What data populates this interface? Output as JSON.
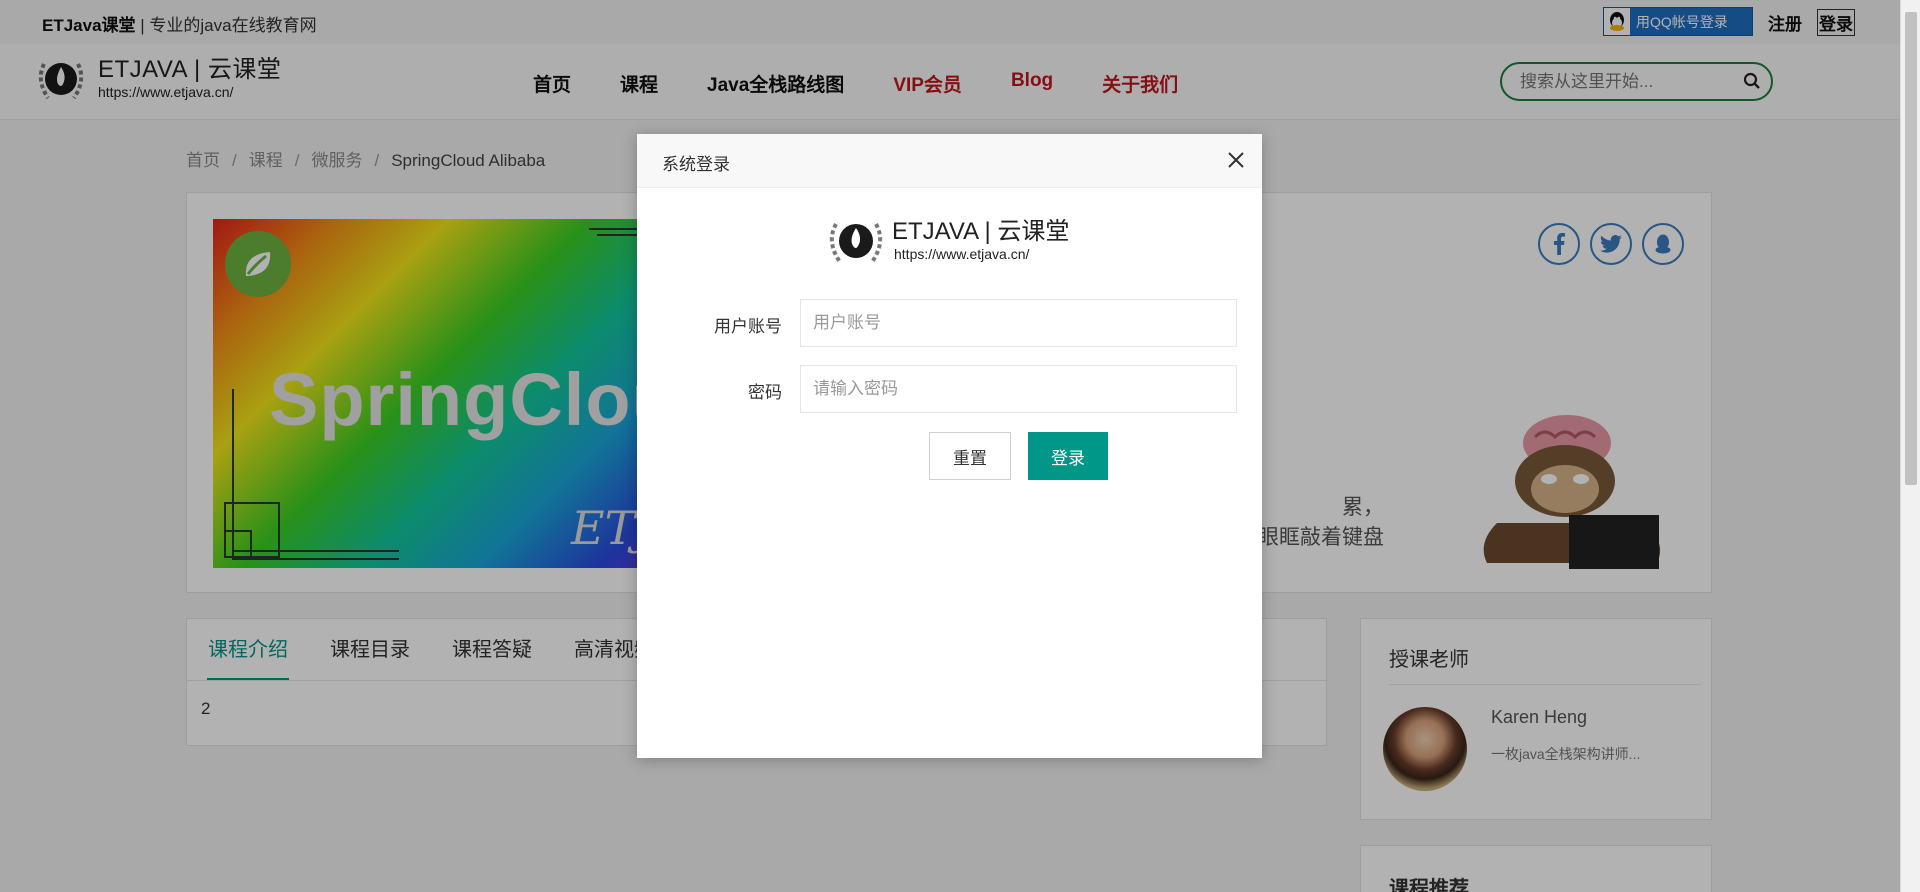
{
  "topbar": {
    "site_name": "ETJava课堂",
    "site_slogan": " | 专业的java在线教育网",
    "qq_login": "用QQ帐号登录",
    "register": "注册",
    "login": "登录"
  },
  "logo": {
    "title": "ETJAVA | 云课堂",
    "url": "https://www.etjava.cn/"
  },
  "nav": {
    "items": [
      {
        "label": "首页",
        "color": "#111111"
      },
      {
        "label": "课程",
        "color": "#111111"
      },
      {
        "label": "Java全栈路线图",
        "color": "#111111"
      },
      {
        "label": "VIP会员",
        "color": "#c0161c"
      },
      {
        "label": "Blog",
        "color": "#c0161c"
      },
      {
        "label": "关于我们",
        "color": "#c0161c"
      }
    ],
    "search_placeholder": "搜索从这里开始..."
  },
  "breadcrumb": {
    "items": [
      "首页",
      "课程",
      "微服务"
    ],
    "separator": "/",
    "current": "SpringCloud Alibaba"
  },
  "course": {
    "banner_text": "SpringCloud",
    "banner_sig": "ETJ",
    "quote_line1": "累，",
    "quote_line2": "着眼眶敲着键盘",
    "social_icons": [
      "facebook-icon",
      "twitter-icon",
      "qq-icon"
    ]
  },
  "tabs": {
    "items": [
      "课程介绍",
      "课程目录",
      "课程答疑",
      "高清视频"
    ],
    "active_index": 0,
    "body": "2"
  },
  "teacher": {
    "heading": "授课老师",
    "name": "Karen Heng",
    "desc": "一枚java全栈架构讲师..."
  },
  "recommend": {
    "heading": "课程推荐"
  },
  "modal": {
    "title": "系统登录",
    "logo_title": "ETJAVA | 云课堂",
    "logo_url": "https://www.etjava.cn/",
    "username_label": "用户账号",
    "username_placeholder": "用户账号",
    "password_label": "密码",
    "password_placeholder": "请输入密码",
    "reset_button": "重置",
    "login_button": "登录"
  },
  "colors": {
    "accent": "#009688",
    "brand_red": "#c0161c",
    "search_border": "#1a7d3a",
    "qq_blue": "#1e6fc0"
  }
}
